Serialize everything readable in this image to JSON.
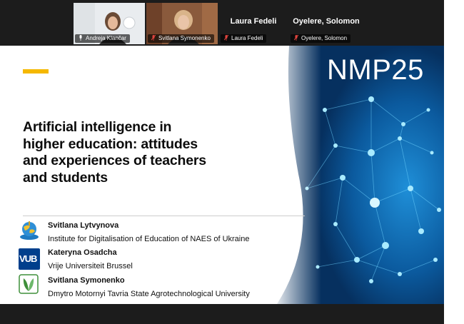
{
  "participants": [
    {
      "name": "Andreja Klančar",
      "has_video": true,
      "label_icon": "microphone-icon"
    },
    {
      "name": "Svitlana Symonenko",
      "has_video": true,
      "label_icon": "microphone-muted-icon"
    },
    {
      "name": "Laura Fedeli",
      "display_name": "Laura Fedeli",
      "has_video": false,
      "label_icon": "microphone-muted-icon"
    },
    {
      "name": "Oyelere, Solomon",
      "display_name": "Oyelere, Solomon",
      "has_video": false,
      "label_icon": "microphone-muted-icon"
    }
  ],
  "slide": {
    "conference_tag": "NMP25",
    "title": "Artificial intelligence in\nhigher education: attitudes\nand experiences of teachers\nand students",
    "accent_color": "#f5b800",
    "authors": [
      {
        "name": "Svitlana Lytvynova",
        "affiliation": "Institute for Digitalisation of Education of NAES of Ukraine",
        "logo": "naes-globe-logo"
      },
      {
        "name": "Kateryna Osadcha",
        "affiliation": "Vrije Universiteit Brussel",
        "logo": "vub-logo",
        "logo_text": "VUB"
      },
      {
        "name": "Svitlana Symonenko",
        "affiliation": "Dmytro Motornyi Tavria State Agrotechnological University",
        "logo": "leaf-logo"
      }
    ]
  },
  "colors": {
    "meeting_background": "#1c1c1c",
    "mic_muted": "#e0443e",
    "slide_panel_blue": "#0b4f8f",
    "vub_blue": "#003f8c",
    "leaf_green": "#3f8f3a"
  }
}
